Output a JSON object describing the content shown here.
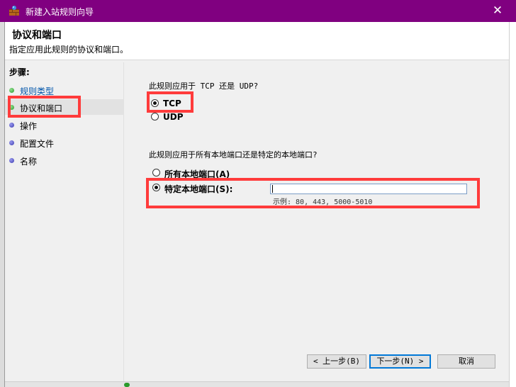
{
  "window": {
    "title": "新建入站规则向导",
    "close_glyph": "✕"
  },
  "header": {
    "title": "协议和端口",
    "subtitle": "指定应用此规则的协议和端口。"
  },
  "steps": {
    "title": "步骤:",
    "items": [
      {
        "label": "规则类型",
        "state": "done"
      },
      {
        "label": "协议和端口",
        "state": "current"
      },
      {
        "label": "操作",
        "state": "pending"
      },
      {
        "label": "配置文件",
        "state": "pending"
      },
      {
        "label": "名称",
        "state": "pending"
      }
    ]
  },
  "protocol": {
    "question": "此规则应用于 TCP 还是 UDP?",
    "options": [
      {
        "label": "TCP",
        "selected": true
      },
      {
        "label": "UDP",
        "selected": false
      }
    ]
  },
  "ports": {
    "question": "此规则应用于所有本地端口还是特定的本地端口?",
    "options": [
      {
        "label": "所有本地端口(A)",
        "selected": false
      },
      {
        "label": "特定本地端口(S):",
        "selected": true
      }
    ],
    "input_value": "",
    "example": "示例: 80, 443, 5000-5010"
  },
  "buttons": {
    "back": "< 上一步(B)",
    "next": "下一步(N) >",
    "cancel": "取消"
  },
  "colors": {
    "titlebar": "#800080",
    "highlight": "#ff3b3b",
    "step_done": "#0055aa"
  }
}
